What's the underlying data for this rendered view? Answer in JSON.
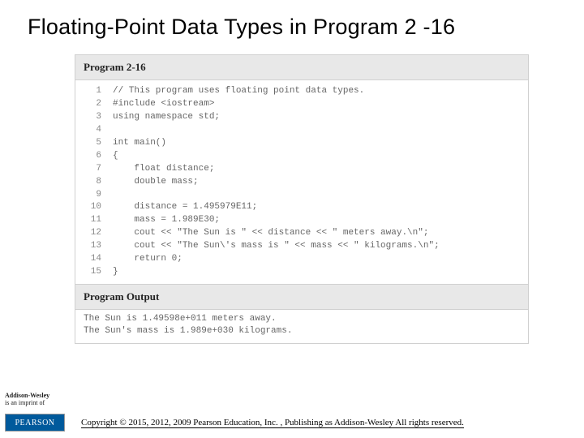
{
  "title": "Floating-Point Data Types in Program 2 -16",
  "program": {
    "header": "Program 2-16",
    "lines": [
      {
        "n": "1",
        "c": "// This program uses floating point data types."
      },
      {
        "n": "2",
        "c": "#include <iostream>"
      },
      {
        "n": "3",
        "c": "using namespace std;"
      },
      {
        "n": "4",
        "c": ""
      },
      {
        "n": "5",
        "c": "int main()"
      },
      {
        "n": "6",
        "c": "{"
      },
      {
        "n": "7",
        "c": "    float distance;"
      },
      {
        "n": "8",
        "c": "    double mass;"
      },
      {
        "n": "9",
        "c": ""
      },
      {
        "n": "10",
        "c": "    distance = 1.495979E11;"
      },
      {
        "n": "11",
        "c": "    mass = 1.989E30;"
      },
      {
        "n": "12",
        "c": "    cout << \"The Sun is \" << distance << \" meters away.\\n\";"
      },
      {
        "n": "13",
        "c": "    cout << \"The Sun\\'s mass is \" << mass << \" kilograms.\\n\";"
      },
      {
        "n": "14",
        "c": "    return 0;"
      },
      {
        "n": "15",
        "c": "}"
      }
    ],
    "output_header": "Program Output",
    "output": [
      "The Sun is 1.49598e+011 meters away.",
      "The Sun's mass is 1.989e+030 kilograms."
    ]
  },
  "publisher": {
    "aw_name": "Addison-Wesley",
    "aw_tag": "is an imprint of",
    "pearson": "PEARSON"
  },
  "copyright": "Copyright © 2015, 2012, 2009 Pearson Education, Inc. , Publishing as Addison-Wesley All rights reserved."
}
